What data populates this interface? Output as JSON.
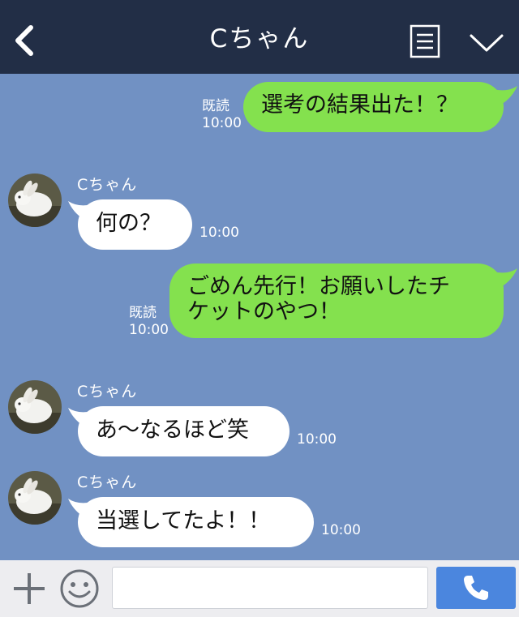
{
  "header": {
    "title": "Cちゃん",
    "back_icon": "chevron-left-icon",
    "menu_icon": "list-icon",
    "dropdown_icon": "chevron-down-icon",
    "background": "#222e46"
  },
  "chat": {
    "background": "#7191c3",
    "outgoing_color": "#84e14e",
    "incoming_color": "#ffffff",
    "messages": [
      {
        "direction": "out",
        "lines": [
          "選考の結果出た！？"
        ],
        "read": "既読",
        "time": "10:00"
      },
      {
        "direction": "in",
        "sender": "Cちゃん",
        "lines": [
          "何の？"
        ],
        "time": "10:00"
      },
      {
        "direction": "out",
        "lines": [
          "ごめん先行！お願いしたチ",
          "ケットのやつ！"
        ],
        "read": "既読",
        "time": "10:00"
      },
      {
        "direction": "in",
        "sender": "Cちゃん",
        "lines": [
          "あ〜なるほど笑"
        ],
        "time": "10:00"
      },
      {
        "direction": "in",
        "sender": "Cちゃん",
        "lines": [
          "当選してたよ！！"
        ],
        "time": "10:00"
      }
    ]
  },
  "footer": {
    "plus_icon": "plus-icon",
    "emoji_icon": "emoji-icon",
    "input_value": "",
    "call_icon": "phone-icon",
    "call_color": "#4b86de"
  }
}
